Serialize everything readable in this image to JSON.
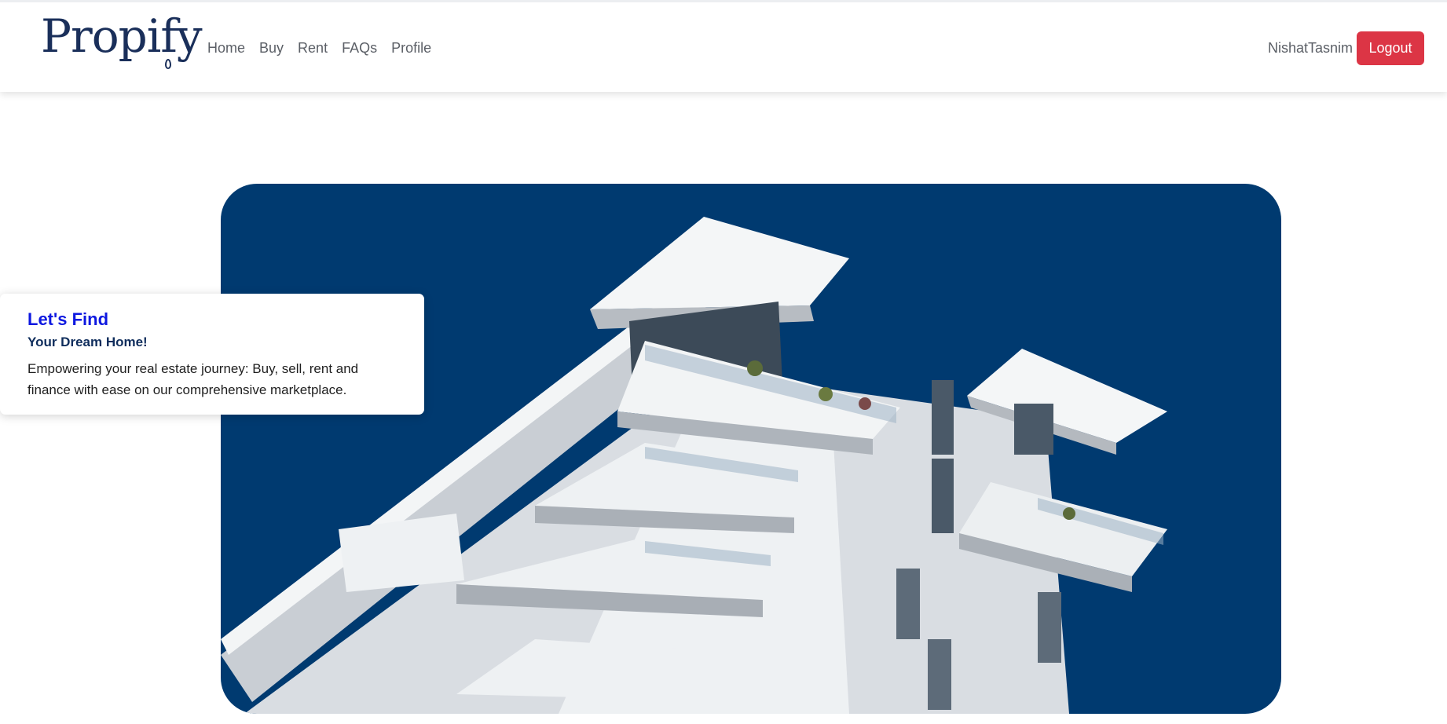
{
  "brand": {
    "logo_text": "Propify"
  },
  "nav": {
    "items": [
      {
        "label": "Home"
      },
      {
        "label": "Buy"
      },
      {
        "label": "Rent"
      },
      {
        "label": "FAQs"
      },
      {
        "label": "Profile"
      }
    ]
  },
  "user": {
    "name": "NishatTasnim",
    "logout_label": "Logout"
  },
  "hero": {
    "title": "Let's Find",
    "subtitle": "Your Dream Home!",
    "description": "Empowering your real estate journey: Buy, sell, rent and finance with ease on our comprehensive marketplace."
  },
  "colors": {
    "brand_navy": "#1a2f5a",
    "hero_background": "#003a70",
    "logout_red": "#dc3545",
    "title_blue": "#0d18e0"
  }
}
